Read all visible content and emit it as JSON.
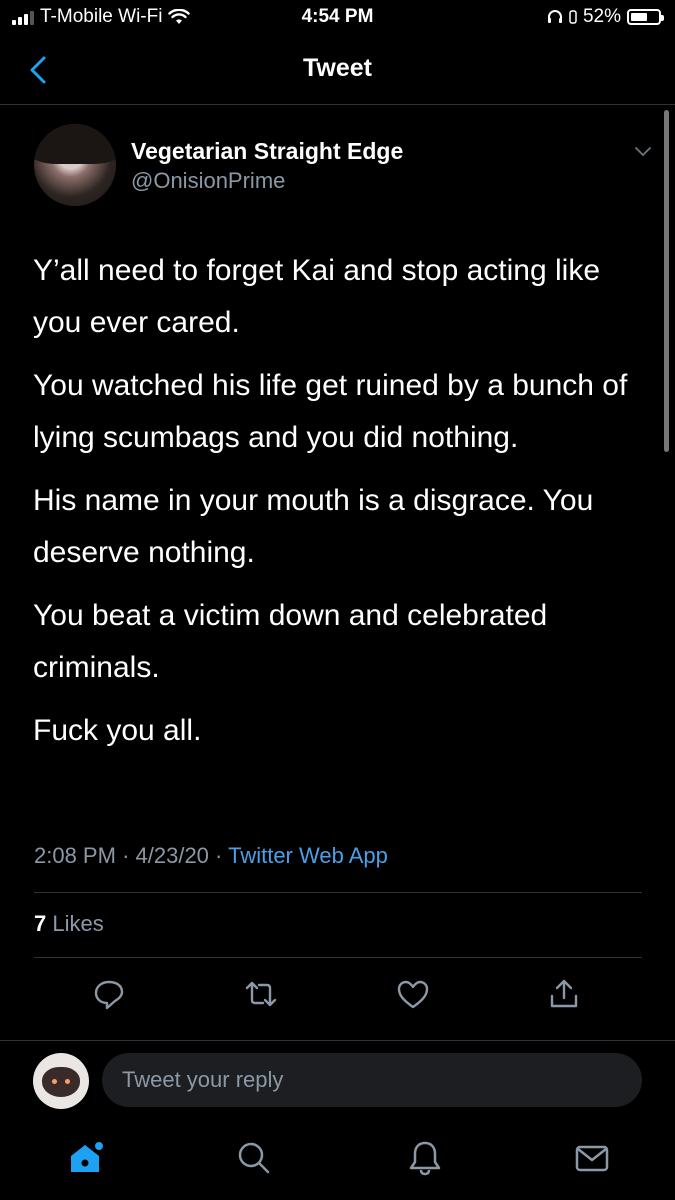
{
  "status_bar": {
    "carrier": "T-Mobile Wi-Fi",
    "time": "4:54 PM",
    "battery": "52%",
    "battery_level": 0.52
  },
  "nav": {
    "title": "Tweet",
    "back_icon": "chevron-left-icon"
  },
  "tweet": {
    "author_name": "Vegetarian Straight Edge",
    "author_handle": "@OnisionPrime",
    "paragraphs": [
      "Y’all need to forget Kai and stop acting like you ever cared.",
      "You watched his life get ruined by a bunch of lying scumbags and you did nothing.",
      "His name in your mouth is a disgrace. You deserve nothing.",
      "You beat a victim down and celebrated criminals.",
      "Fuck you all."
    ],
    "time": "2:08 PM",
    "date": "4/23/20",
    "source": "Twitter Web App",
    "likes_count": "7",
    "likes_label": "Likes"
  },
  "actions": [
    "reply-icon",
    "retweet-icon",
    "like-icon",
    "share-icon"
  ],
  "reply": {
    "placeholder": "Tweet your reply"
  },
  "tabbar": [
    "home-icon",
    "search-icon",
    "notifications-icon",
    "messages-icon"
  ],
  "colors": {
    "accent": "#1da1f2",
    "link": "#4b9fe8",
    "muted": "#8b98a5",
    "background": "#000000"
  }
}
